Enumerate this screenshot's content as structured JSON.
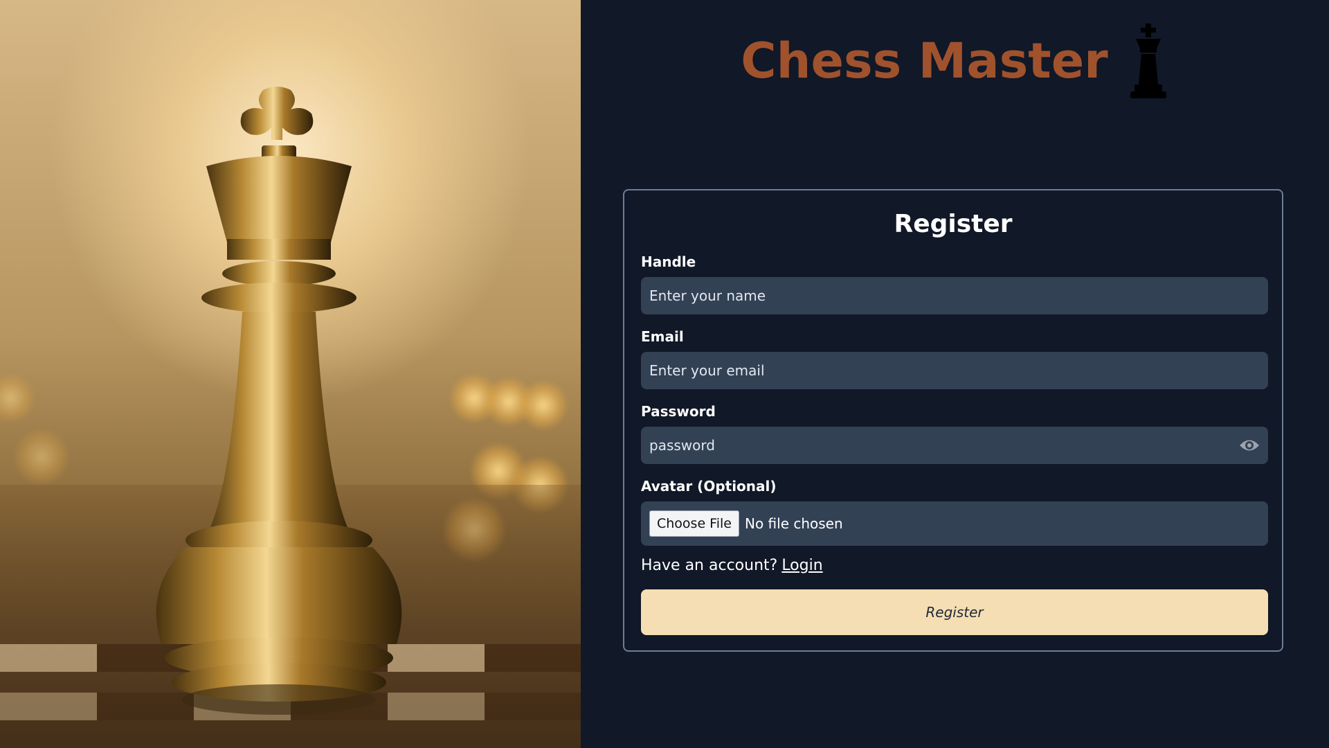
{
  "brand": {
    "title": "Chess Master",
    "icon": "chess-king-icon",
    "color": "#a0522d"
  },
  "hero": {
    "image": "golden-chess-king-photo"
  },
  "form": {
    "title": "Register",
    "handle": {
      "label": "Handle",
      "placeholder": "Enter your name",
      "value": ""
    },
    "email": {
      "label": "Email",
      "placeholder": "Enter your email",
      "value": ""
    },
    "password": {
      "label": "Password",
      "placeholder": "password",
      "value": "",
      "toggle_icon": "eye-icon"
    },
    "avatar": {
      "label": "Avatar (Optional)",
      "button_label": "Choose File",
      "status": "No file chosen"
    },
    "account_prompt": "Have an account?",
    "login_link": "Login",
    "submit_label": "Register"
  },
  "colors": {
    "background": "#111827",
    "input_bg": "#334155",
    "card_border": "#6b7f99",
    "submit_bg": "#f5deb3"
  }
}
